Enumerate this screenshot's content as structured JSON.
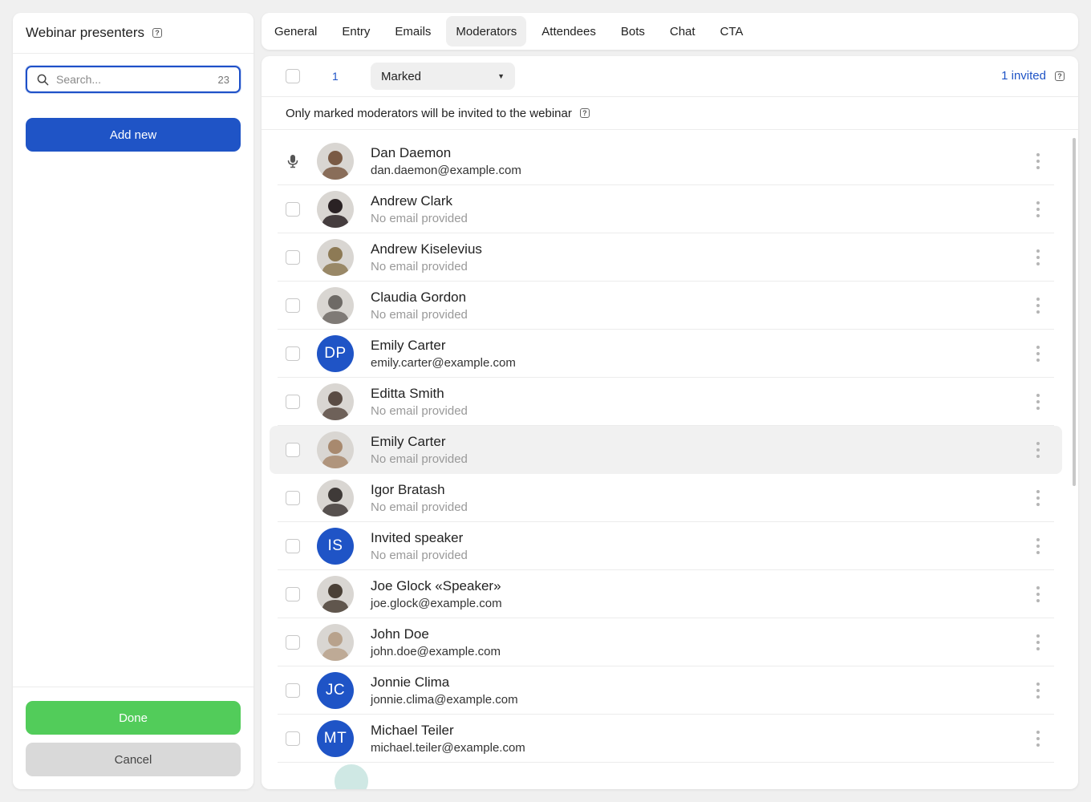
{
  "sidebar": {
    "title": "Webinar presenters",
    "search_placeholder": "Search...",
    "search_count": "23",
    "add_label": "Add new",
    "done_label": "Done",
    "cancel_label": "Cancel"
  },
  "tabs": [
    {
      "label": "General"
    },
    {
      "label": "Entry"
    },
    {
      "label": "Emails"
    },
    {
      "label": "Moderators",
      "active": true
    },
    {
      "label": "Attendees"
    },
    {
      "label": "Bots"
    },
    {
      "label": "Chat"
    },
    {
      "label": "CTA"
    }
  ],
  "toolbar": {
    "selected_count": "1",
    "filter_value": "Marked",
    "invited_label": "1 invited"
  },
  "info_text": "Only marked moderators will be invited to the webinar",
  "moderators": [
    {
      "name": "Dan Daemon",
      "email": "dan.daemon@example.com",
      "avatar": "photo",
      "tone": "#7a5a44",
      "host": true
    },
    {
      "name": "Andrew Clark",
      "email": "No email provided",
      "avatar": "photo",
      "tone": "#2a2224",
      "muted": true
    },
    {
      "name": "Andrew Kiselevius",
      "email": "No email provided",
      "avatar": "photo",
      "tone": "#8d7a55",
      "muted": true
    },
    {
      "name": "Claudia Gordon",
      "email": "No email provided",
      "avatar": "photo",
      "tone": "#6e6a66",
      "muted": true
    },
    {
      "name": "Emily Carter",
      "email": "emily.carter@example.com",
      "avatar": "initials",
      "initials": "DP"
    },
    {
      "name": "Editta Smith",
      "email": "No email provided",
      "avatar": "photo",
      "tone": "#5a4c44",
      "muted": true
    },
    {
      "name": "Emily Carter",
      "email": "No email provided",
      "avatar": "photo",
      "tone": "#a8896e",
      "muted": true,
      "hover": true
    },
    {
      "name": "Igor Bratash",
      "email": "No email provided",
      "avatar": "photo",
      "tone": "#3f3a38",
      "muted": true
    },
    {
      "name": "Invited speaker",
      "email": "No email provided",
      "avatar": "initials",
      "initials": "IS",
      "muted": true
    },
    {
      "name": "Joe Glock «Speaker»",
      "email": "joe.glock@example.com",
      "avatar": "photo",
      "tone": "#4a4036"
    },
    {
      "name": "John Doe",
      "email": "john.doe@example.com",
      "avatar": "photo",
      "tone": "#b8a28c"
    },
    {
      "name": "Jonnie Clima",
      "email": "jonnie.clima@example.com",
      "avatar": "initials",
      "initials": "JC"
    },
    {
      "name": "Michael Teiler",
      "email": "michael.teiler@example.com",
      "avatar": "initials",
      "initials": "MT"
    }
  ],
  "colors": {
    "accent": "#1f54c6",
    "success": "#52cc5a",
    "muted_text": "#999999"
  }
}
